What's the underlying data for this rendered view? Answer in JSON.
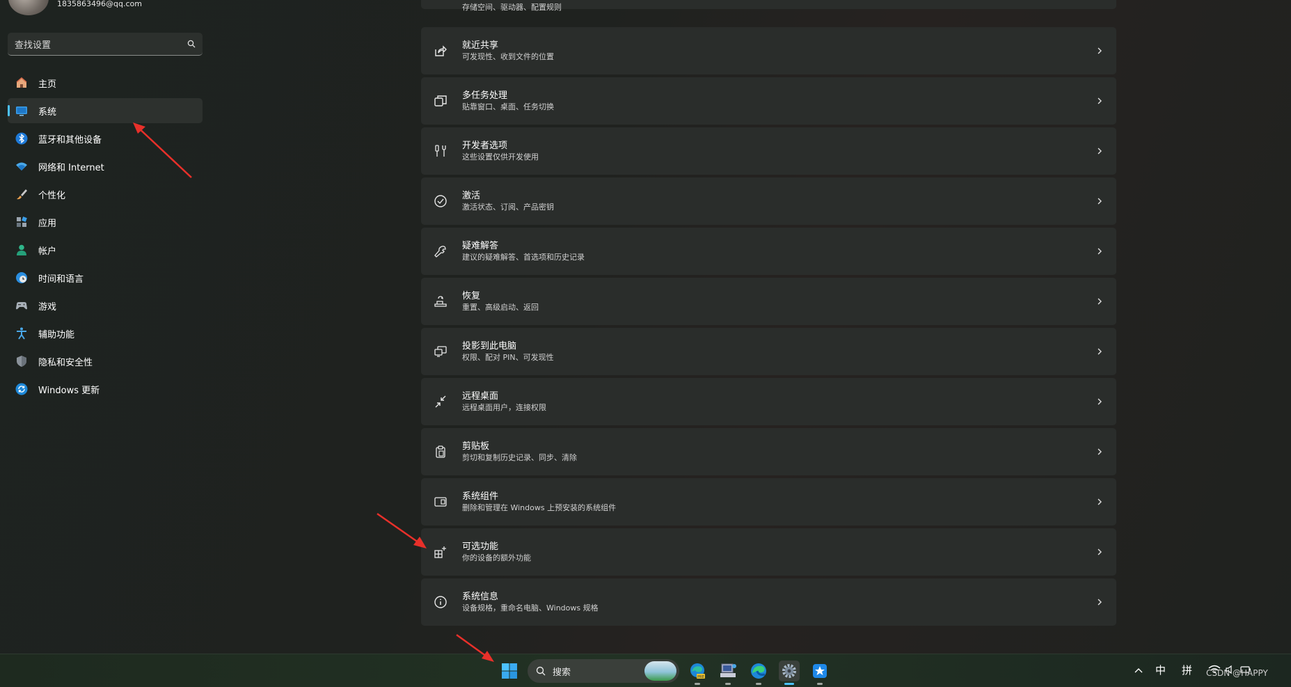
{
  "user": {
    "email": "1835863496@qq.com"
  },
  "search": {
    "placeholder": "查找设置"
  },
  "sidebar": {
    "items": [
      {
        "label": "主页",
        "icon": "home-icon"
      },
      {
        "label": "系统",
        "icon": "system-display-icon",
        "active": true
      },
      {
        "label": "蓝牙和其他设备",
        "icon": "bluetooth-icon"
      },
      {
        "label": "网络和 Internet",
        "icon": "wifi-icon"
      },
      {
        "label": "个性化",
        "icon": "brush-icon"
      },
      {
        "label": "应用",
        "icon": "apps-icon"
      },
      {
        "label": "帐户",
        "icon": "account-icon"
      },
      {
        "label": "时间和语言",
        "icon": "globe-clock-icon"
      },
      {
        "label": "游戏",
        "icon": "gamepad-icon"
      },
      {
        "label": "辅助功能",
        "icon": "accessibility-icon"
      },
      {
        "label": "隐私和安全性",
        "icon": "shield-icon"
      },
      {
        "label": "Windows 更新",
        "icon": "update-icon"
      }
    ]
  },
  "main": {
    "top_partial_sub": "存储空间、驱动器、配置规则",
    "settings": [
      {
        "title": "就近共享",
        "subtitle": "可发现性、收到文件的位置",
        "icon": "share-icon"
      },
      {
        "title": "多任务处理",
        "subtitle": "贴靠窗口、桌面、任务切换",
        "icon": "multitask-icon"
      },
      {
        "title": "开发者选项",
        "subtitle": "这些设置仅供开发使用",
        "icon": "developer-tools-icon"
      },
      {
        "title": "激活",
        "subtitle": "激活状态、订阅、产品密钥",
        "icon": "check-circle-icon"
      },
      {
        "title": "疑难解答",
        "subtitle": "建议的疑难解答、首选项和历史记录",
        "icon": "wrench-icon"
      },
      {
        "title": "恢复",
        "subtitle": "重置、高级启动、返回",
        "icon": "recovery-icon"
      },
      {
        "title": "投影到此电脑",
        "subtitle": "权限、配对 PIN、可发现性",
        "icon": "project-icon"
      },
      {
        "title": "远程桌面",
        "subtitle": "远程桌面用户，连接权限",
        "icon": "remote-desktop-icon"
      },
      {
        "title": "剪贴板",
        "subtitle": "剪切和复制历史记录、同步、清除",
        "icon": "clipboard-icon"
      },
      {
        "title": "系统组件",
        "subtitle": "删除和管理在 Windows 上预安装的系统组件",
        "icon": "components-icon"
      },
      {
        "title": "可选功能",
        "subtitle": "你的设备的额外功能",
        "icon": "optional-features-icon"
      },
      {
        "title": "系统信息",
        "subtitle": "设备规格，重命名电脑、Windows 规格",
        "icon": "info-icon"
      }
    ]
  },
  "taskbar": {
    "search_label": "搜索",
    "apps": [
      "edge-beta-icon",
      "network-app-icon",
      "edge-icon",
      "settings-gear-icon",
      "store-star-icon"
    ],
    "tray": {
      "ime_lang": "中",
      "ime_mode": "拼"
    }
  },
  "watermark": "CSDN @HAPPY",
  "colors": {
    "accent": "#4cc2ff",
    "annotation_arrow": "#e8302a"
  }
}
